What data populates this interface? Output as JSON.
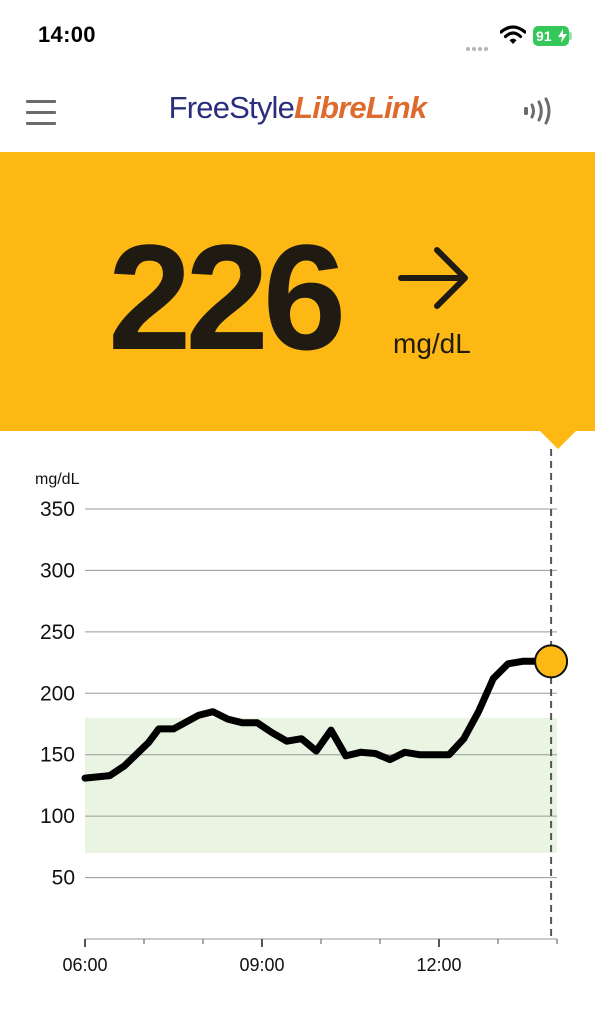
{
  "status_bar": {
    "time": "14:00",
    "battery_level": "91",
    "icons": [
      "signal-dots-icon",
      "wifi-icon",
      "battery-charging-icon"
    ]
  },
  "header": {
    "brand_part1": "FreeStyle",
    "brand_part2": "LibreLink",
    "menu_icon": "hamburger-menu-icon",
    "scan_icon": "nfc-scan-icon",
    "brand_colors": {
      "freestyle": "#2a2f7d",
      "librelink": "#df6a2e"
    }
  },
  "reading": {
    "value": "226",
    "unit": "mg/dL",
    "trend": "steady",
    "trend_icon": "arrow-right-icon",
    "panel_color": "#fdb813"
  },
  "chart_data": {
    "type": "line",
    "ylabel": "mg/dL",
    "ylim": [
      0,
      350
    ],
    "y_ticks": [
      50,
      100,
      150,
      200,
      250,
      300,
      350
    ],
    "y_tick_labels": [
      "50",
      "100",
      "150",
      "200",
      "250",
      "300",
      "350"
    ],
    "x_tick_labels": [
      "06:00",
      "09:00",
      "12:00"
    ],
    "x_tick_hours": [
      6,
      9,
      12
    ],
    "xlim_hours": [
      6,
      14
    ],
    "target_range": [
      70,
      180
    ],
    "target_range_color": "#e9f4e2",
    "line_color": "#000000",
    "marker_color": "#fdb813",
    "grid": true,
    "current_time_line": true,
    "series": [
      {
        "x_hours": [
          6.0,
          6.42,
          6.67,
          7.08,
          7.25,
          7.5,
          7.92,
          8.17,
          8.42,
          8.67,
          8.92,
          9.17,
          9.42,
          9.67,
          9.92,
          10.17,
          10.42,
          10.67,
          10.92,
          11.17,
          11.42,
          11.67,
          11.92,
          12.17,
          12.42,
          12.67,
          12.92,
          13.17,
          13.42,
          13.58,
          13.9
        ],
        "values": [
          131,
          133,
          141,
          160,
          171,
          171,
          182,
          185,
          179,
          176,
          176,
          168,
          161,
          163,
          153,
          170,
          149,
          152,
          151,
          146,
          152,
          150,
          150,
          150,
          163,
          185,
          212,
          224,
          226,
          226,
          226
        ]
      }
    ]
  }
}
